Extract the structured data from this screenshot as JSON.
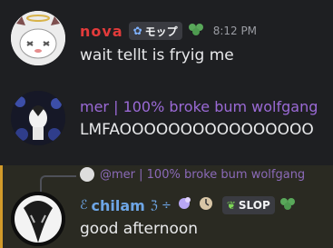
{
  "messages": [
    {
      "username": "nova",
      "tag_text": "モップ",
      "time": "8:12 PM",
      "text": "wait tellt is fryig me"
    },
    {
      "username": "mer | 100% broke bum wolfgang",
      "text": "LMFAOOOOOOOOOOOOOOOO"
    },
    {
      "reply_to": "@mer | 100% broke bum wolfgang",
      "username_prefix": "ℰ",
      "username": "chilam",
      "username_suffix": "ℨ ÷",
      "tag_text": "SLOP",
      "text": "good afternoon"
    }
  ],
  "colors": {
    "background": "#1e1f22",
    "nova": "#e23b3b",
    "mer": "#9b6ad6",
    "chilam": "#6ea6e6",
    "highlight_border": "#d29a2a"
  }
}
